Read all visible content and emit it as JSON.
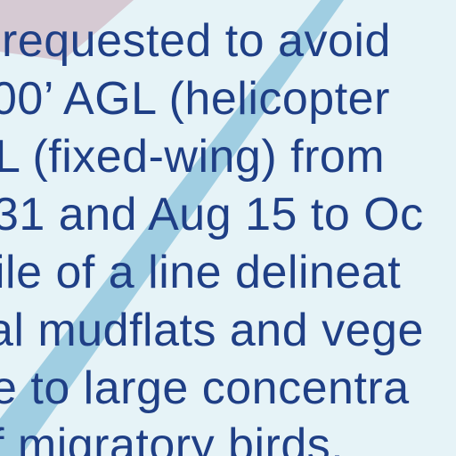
{
  "notice": {
    "lines": [
      "requested to avoid",
      "00’ AGL (helicopter",
      "L (fixed-wing) from",
      "31 and Aug 15 to Oc",
      "ile of a line delineat",
      "al mudflats and vege",
      "e to large concentra",
      "f migratory birds."
    ]
  },
  "colors": {
    "background": "#e6f3f7",
    "text": "#1f3f86",
    "diagonal_band": "#9ccbe0",
    "corner_patch": "#c9a8b6"
  }
}
